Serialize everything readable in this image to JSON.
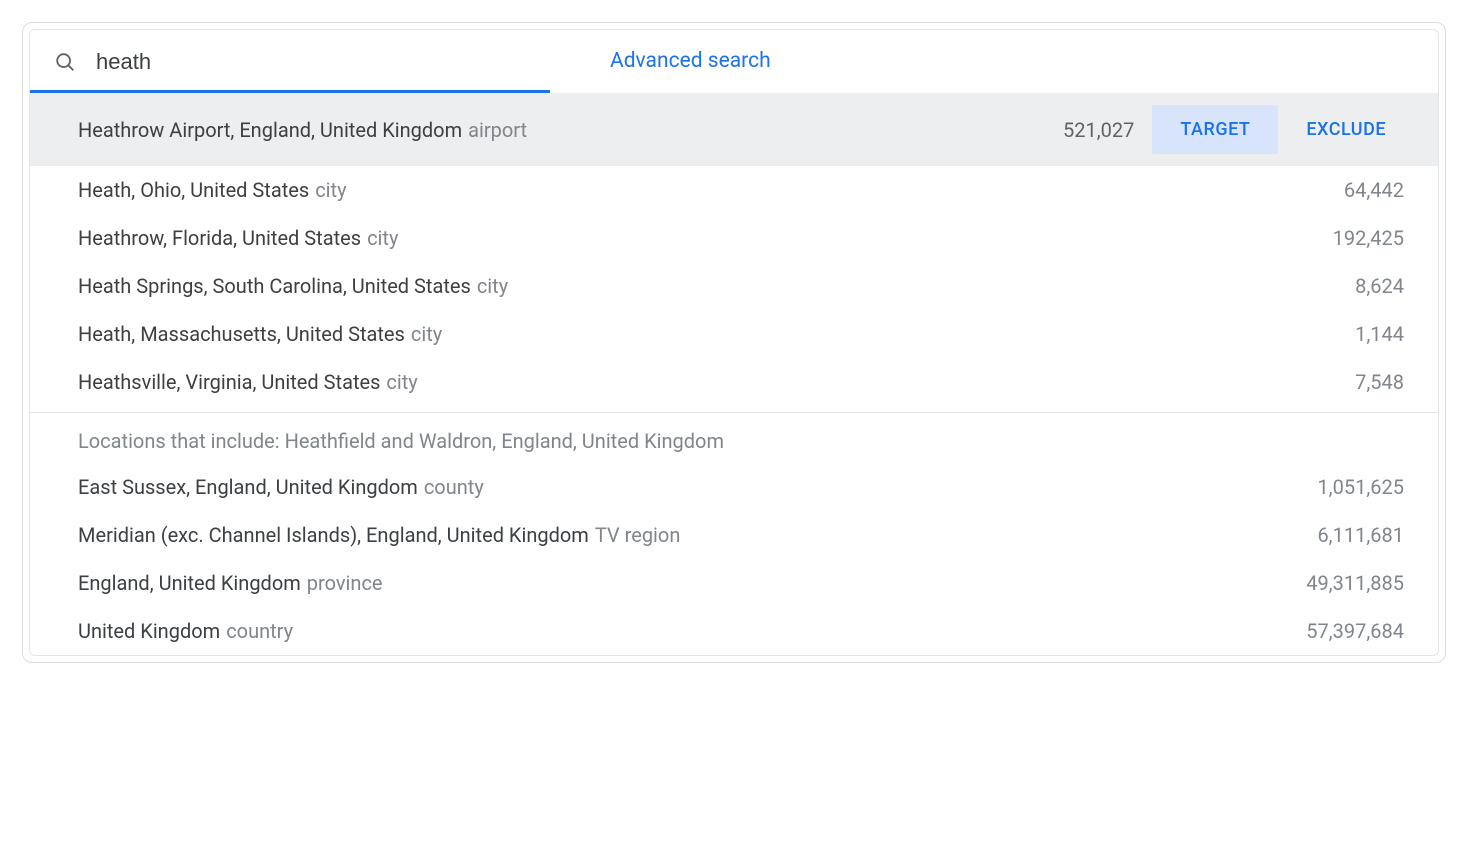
{
  "search": {
    "value": "heath",
    "advanced_label": "Advanced search"
  },
  "actions": {
    "target": "TARGET",
    "exclude": "EXCLUDE"
  },
  "results": [
    {
      "name": "Heathrow Airport, England, United Kingdom",
      "type": "airport",
      "count": "521,027",
      "highlight": true
    },
    {
      "name": "Heath, Ohio, United States",
      "type": "city",
      "count": "64,442"
    },
    {
      "name": "Heathrow, Florida, United States",
      "type": "city",
      "count": "192,425"
    },
    {
      "name": "Heath Springs, South Carolina, United States",
      "type": "city",
      "count": "8,624"
    },
    {
      "name": "Heath, Massachusetts, United States",
      "type": "city",
      "count": "1,144"
    },
    {
      "name": "Heathsville, Virginia, United States",
      "type": "city",
      "count": "7,548"
    }
  ],
  "include_header": "Locations that include: Heathfield and Waldron, England, United Kingdom",
  "include_results": [
    {
      "name": "East Sussex, England, United Kingdom",
      "type": "county",
      "count": "1,051,625"
    },
    {
      "name": "Meridian (exc. Channel Islands), England, United Kingdom",
      "type": "TV region",
      "count": "6,111,681"
    },
    {
      "name": "England, United Kingdom",
      "type": "province",
      "count": "49,311,885"
    },
    {
      "name": "United Kingdom",
      "type": "country",
      "count": "57,397,684"
    }
  ]
}
